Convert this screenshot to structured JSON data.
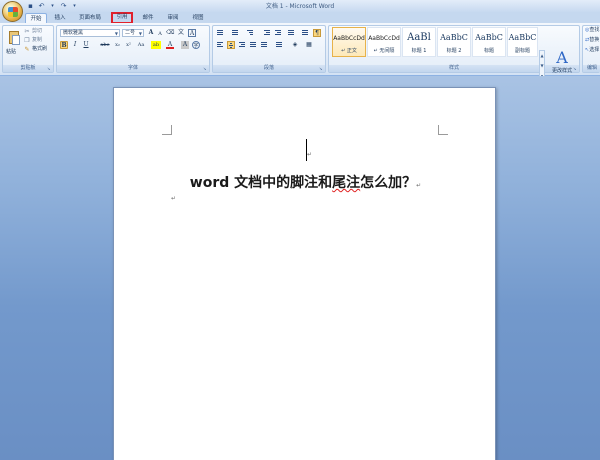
{
  "window": {
    "title": "文档 1 - Microsoft Word"
  },
  "quick_access": {
    "save_icon": "save-icon",
    "undo_icon": "undo-icon",
    "redo_icon": "redo-icon",
    "customize_icon": "dropdown-icon"
  },
  "tabs": [
    {
      "label": "开始",
      "active": true
    },
    {
      "label": "插入"
    },
    {
      "label": "页面布局"
    },
    {
      "label": "引用",
      "highlighted": true
    },
    {
      "label": "邮件"
    },
    {
      "label": "审阅"
    },
    {
      "label": "视图"
    }
  ],
  "ribbon": {
    "clipboard": {
      "group_label": "剪贴板",
      "paste_label": "粘贴",
      "cut_label": "剪切",
      "copy_label": "复制",
      "format_painter_label": "格式刷"
    },
    "font": {
      "group_label": "字体",
      "font_name": "微软雅黑",
      "font_size": "二号",
      "bold": "B",
      "italic": "I",
      "underline": "U",
      "strike": "abe",
      "subscript": "x₂",
      "superscript": "x²",
      "change_case": "Aa",
      "grow_font": "A",
      "shrink_font": "A",
      "clear_format": "⌫",
      "phonetic": "文",
      "char_border": "A",
      "highlight": "ab",
      "font_color": "A",
      "char_shading": "A",
      "enclose": "字"
    },
    "paragraph": {
      "group_label": "段落"
    },
    "styles": {
      "group_label": "样式",
      "items": [
        {
          "sample": "AaBbCcDd",
          "name": "↵ 正文",
          "selected": true
        },
        {
          "sample": "AaBbCcDd",
          "name": "↵ 无间隔"
        },
        {
          "sample": "AaBl",
          "name": "标题 1"
        },
        {
          "sample": "AaBbC",
          "name": "标题 2"
        },
        {
          "sample": "AaBbC",
          "name": "标题"
        },
        {
          "sample": "AaBbC",
          "name": "副标题"
        }
      ],
      "change_styles_label": "更改样式"
    },
    "editing": {
      "group_label": "编辑",
      "find_label": "查找",
      "replace_label": "替换",
      "select_label": "选择"
    }
  },
  "document": {
    "heading_before": "word 文档中的脚注和",
    "heading_misspelled": "尾注",
    "heading_after": "怎么加？",
    "paragraph_mark": "↵"
  }
}
